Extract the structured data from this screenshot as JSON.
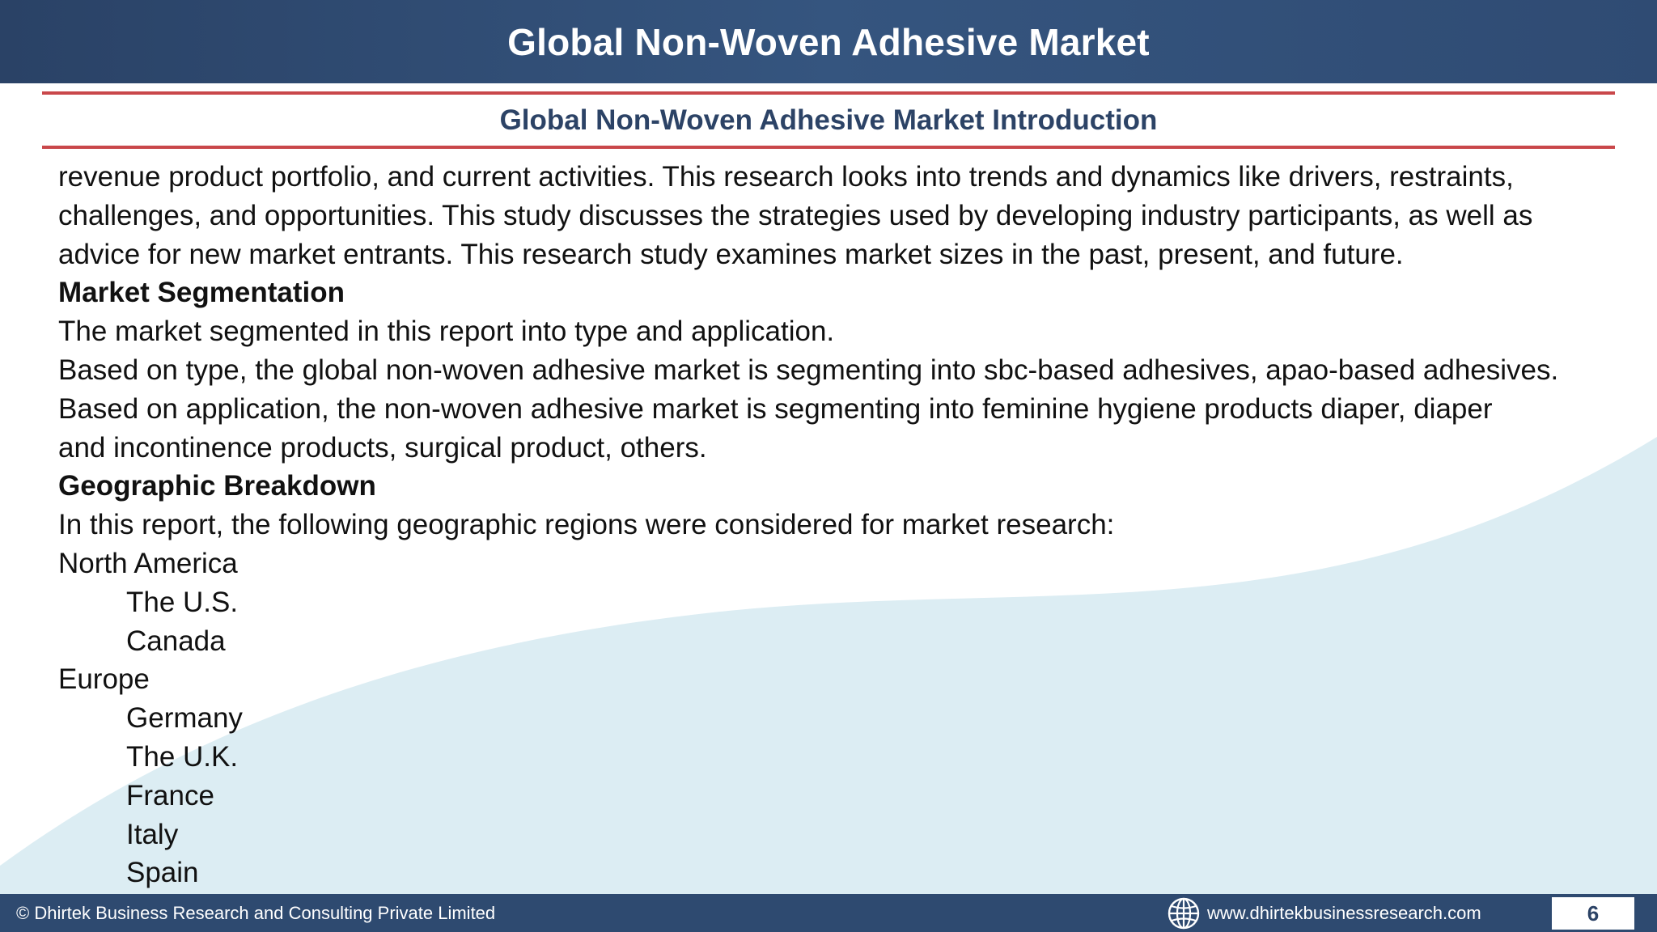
{
  "header": {
    "title": "Global Non-Woven Adhesive Market"
  },
  "section": {
    "title": "Global Non-Woven Adhesive Market Introduction"
  },
  "body": {
    "intro_lines": [
      "revenue product portfolio, and current activities. This research looks into trends and dynamics like drivers, restraints,",
      "challenges, and opportunities. This study discusses the strategies used by developing industry participants, as well as",
      "advice for new market entrants. This research study examines market sizes in the past, present, and future."
    ],
    "segmentation": {
      "heading": "Market Segmentation",
      "lines": [
        "The market segmented in this report into type and application.",
        "Based on type, the global non-woven adhesive market is segmenting into sbc-based adhesives, apao-based adhesives.",
        "Based on application, the non-woven adhesive market is segmenting into feminine hygiene products diaper, diaper",
        "and incontinence products, surgical product, others."
      ]
    },
    "geography": {
      "heading": "Geographic Breakdown",
      "intro": "In this report, the following geographic regions were considered for market research:",
      "regions": [
        {
          "name": "North America",
          "countries": [
            "The U.S.",
            "Canada"
          ]
        },
        {
          "name": "Europe",
          "countries": [
            "Germany",
            "The U.K.",
            "France",
            "Italy",
            "Spain"
          ]
        }
      ]
    }
  },
  "footer": {
    "copyright": "© Dhirtek Business Research and Consulting Private Limited",
    "website": "www.dhirtekbusinessresearch.com",
    "website_icon": "globe-icon",
    "page_number": "6"
  },
  "colors": {
    "header_bg": "#2f4b73",
    "accent_rule": "#c9474a",
    "subtitle_text": "#2c4366",
    "wave_fill": "#dcedf3"
  }
}
